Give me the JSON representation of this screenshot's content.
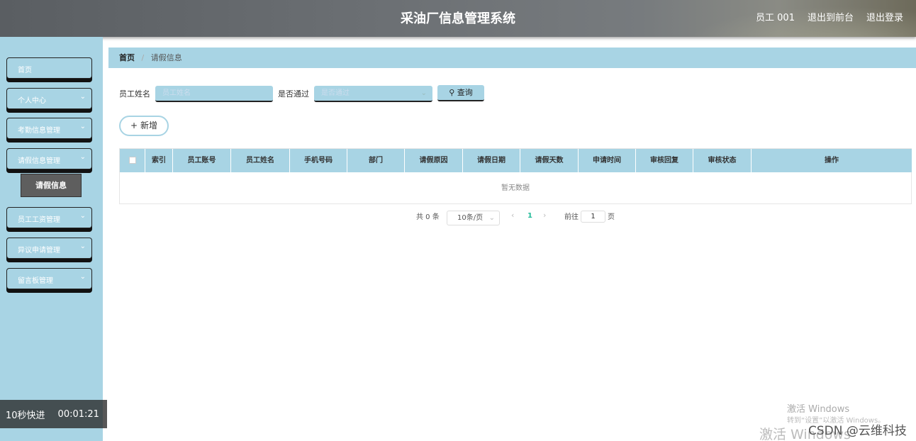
{
  "header": {
    "title": "采油厂信息管理系统",
    "user": "员工 001",
    "front_link": "退出到前台",
    "logout_link": "退出登录"
  },
  "sidebar": {
    "items": [
      {
        "label": "首页",
        "has_chevron": false
      },
      {
        "label": "个人中心",
        "has_chevron": true
      },
      {
        "label": "考勤信息管理",
        "has_chevron": true
      },
      {
        "label": "请假信息管理",
        "has_chevron": true
      },
      {
        "label": "员工工资管理",
        "has_chevron": true
      },
      {
        "label": "异议申请管理",
        "has_chevron": true
      },
      {
        "label": "留言板管理",
        "has_chevron": true
      }
    ],
    "sub_item": "请假信息",
    "chevron": "⌄"
  },
  "breadcrumb": {
    "home": "首页",
    "separator": "/",
    "current": "请假信息"
  },
  "search": {
    "name_label": "员工姓名",
    "name_placeholder": "员工姓名",
    "pass_label": "是否通过",
    "pass_placeholder": "是否通过",
    "query_label": "查询",
    "query_icon": "search-icon"
  },
  "actions": {
    "add_label": "新增",
    "add_icon": "plus-icon"
  },
  "table": {
    "columns": [
      "索引",
      "员工账号",
      "员工姓名",
      "手机号码",
      "部门",
      "请假原因",
      "请假日期",
      "请假天数",
      "申请时间",
      "审核回复",
      "审核状态",
      "操作"
    ],
    "empty_text": "暂无数据"
  },
  "pagination": {
    "total": "共 0 条",
    "page_size": "10条/页",
    "current_page": "1",
    "goto_label": "前往",
    "goto_value": "1",
    "page_suffix": "页"
  },
  "overlay": {
    "timer_label": "10秒快进",
    "timer_value": "00:01:21",
    "activate_title": "激活 Windows",
    "activate_hint": "转到“设置”以激活 Windows。",
    "activate_big": "激活 Windows",
    "csdn": "CSDN @云维科技"
  },
  "colors": {
    "accent": "#a8d4e4",
    "header": "#6b6f73",
    "submenu": "#5e5e5e"
  }
}
